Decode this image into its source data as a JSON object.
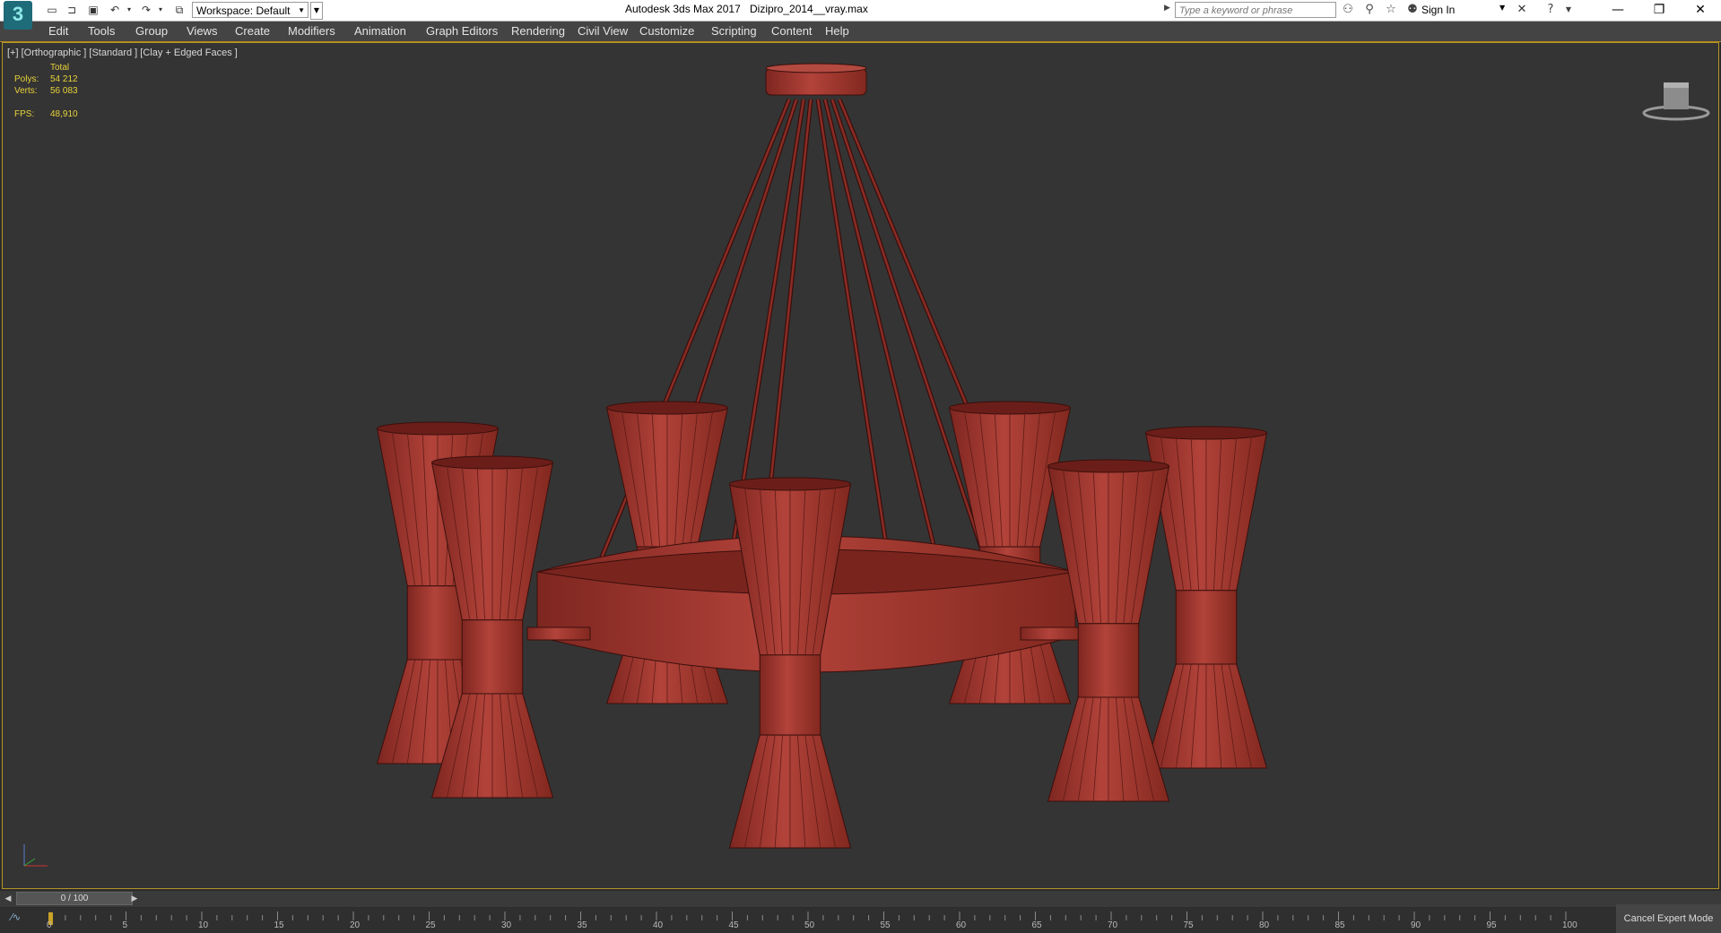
{
  "titlebar": {
    "logo_text": "3",
    "workspace_label": "Workspace: Default",
    "app_title": "Autodesk 3ds Max 2017",
    "file_name": "Dizipro_2014__vray.max",
    "search_placeholder": "Type a keyword or phrase",
    "sign_in": "Sign In"
  },
  "menu": [
    "Edit",
    "Tools",
    "Group",
    "Views",
    "Create",
    "Modifiers",
    "Animation",
    "Graph Editors",
    "Rendering",
    "Civil View",
    "Customize",
    "Scripting",
    "Content",
    "Help"
  ],
  "viewport": {
    "label": "[+] [Orthographic ] [Standard ] [Clay + Edged Faces ]",
    "stats_header": "Total",
    "polys_label": "Polys:",
    "polys_value": "54 212",
    "verts_label": "Verts:",
    "verts_value": "56 083",
    "fps_label": "FPS:",
    "fps_value": "48,910",
    "model_color": "#a83a32",
    "highlight_color": "#b69526"
  },
  "timeline": {
    "frame_display": "0 / 100",
    "tick_labels": [
      "0",
      "5",
      "10",
      "15",
      "20",
      "25",
      "30",
      "35",
      "40",
      "45",
      "50",
      "55",
      "60",
      "65",
      "70",
      "75",
      "80",
      "85",
      "90",
      "95",
      "100"
    ]
  },
  "status": {
    "cancel_expert_mode": "Cancel Expert Mode"
  }
}
